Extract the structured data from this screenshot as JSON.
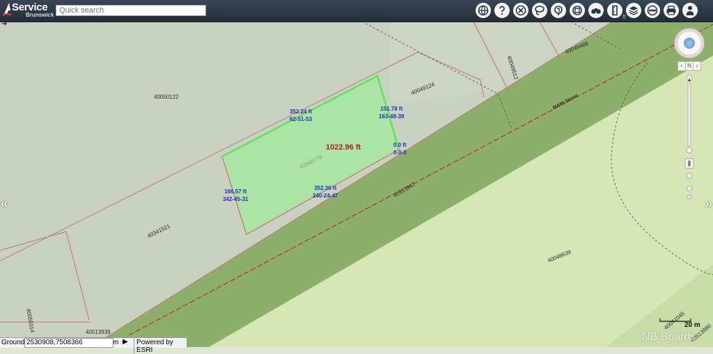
{
  "app": {
    "brand_main": "Service",
    "brand_sub": "Brunswick"
  },
  "search": {
    "placeholder": "Quick search"
  },
  "toolbar": {
    "tools": [
      "globe-icon",
      "help-icon",
      "clear-icon",
      "lasso-select-icon",
      "identify-icon",
      "measure-icon",
      "binoculars-icon",
      "ruler-icon",
      "layers-icon",
      "basemap-icon",
      "print-icon",
      "user-icon"
    ],
    "unit": "ft"
  },
  "parcels": {
    "p1": "40050122",
    "p2": "40049512",
    "p3": "40049488",
    "p4": "40049124",
    "p5": "40048779",
    "p6": "40341521",
    "p7": "40513947",
    "p8": "40050114",
    "p9": "40513939",
    "p10": "40048639",
    "p11": "40041045",
    "p12": "40513980"
  },
  "street": {
    "name": "MAIN Street"
  },
  "measurement": {
    "area": "1022.96 ft",
    "top_len": "352.24 ft",
    "top_brg": "62-51-53",
    "right_len": "151.78 ft",
    "right_brg": "163-48-39",
    "corner_len": "0.0 ft",
    "corner_brg": "0-0-0",
    "bottom_len": "352.36 ft",
    "bottom_brg": "240-24-47",
    "left_len": "166.57 ft",
    "left_brg": "342-45-31"
  },
  "nav": {
    "north": "N"
  },
  "status": {
    "ground_label": "Ground",
    "coords": "2530908,7508366",
    "unit": "m",
    "powered": "Powered by ESRI"
  },
  "scale": {
    "label": "20 m"
  },
  "watermark": "NB Boards"
}
